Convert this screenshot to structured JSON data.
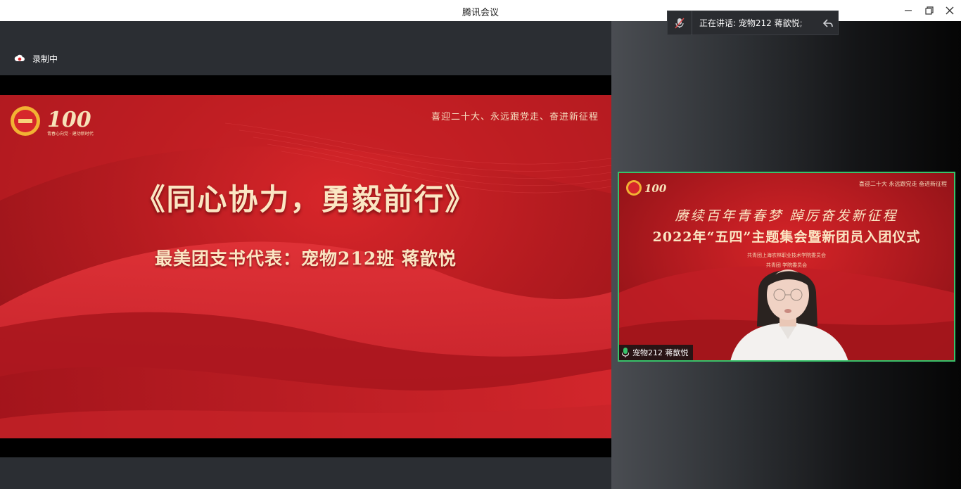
{
  "window": {
    "title": "腾讯会议",
    "controls": [
      "minimize-icon",
      "restore-icon",
      "close-icon"
    ]
  },
  "recording": {
    "label": "录制中",
    "icon": "recording-cloud-icon"
  },
  "shared_slide": {
    "slogan": "喜迎二十大、永远跟党走、奋进新征程",
    "title": "《同心协力，勇毅前行》",
    "subtitle": "最美团支书代表：宠物212班 蒋歆悦",
    "logo_tagline": "青春心向党 · 建功新时代",
    "logo_number": "100"
  },
  "speaking": {
    "label": "正在讲话: 宠物212 蒋歆悦;",
    "icon": "muted-mic-icon"
  },
  "video_tile": {
    "participant_name": "宠物212 蒋歆悦",
    "backdrop_slogan": "喜迎二十大  永远跟党走  奋进新征程",
    "backdrop_line1": "赓续百年青春梦  踔厉奋发新征程",
    "backdrop_line2": "2022年“五四”主题集会暨新团员入团仪式",
    "backdrop_org1": "共青团上海农林职业技术学院委员会",
    "backdrop_org2": "共青团    学院委员会",
    "active_border_color": "#38c26a"
  },
  "colors": {
    "slide_red": "#b51b20",
    "gold_text": "#fbe6c3",
    "speaker_green": "#38c26a"
  }
}
